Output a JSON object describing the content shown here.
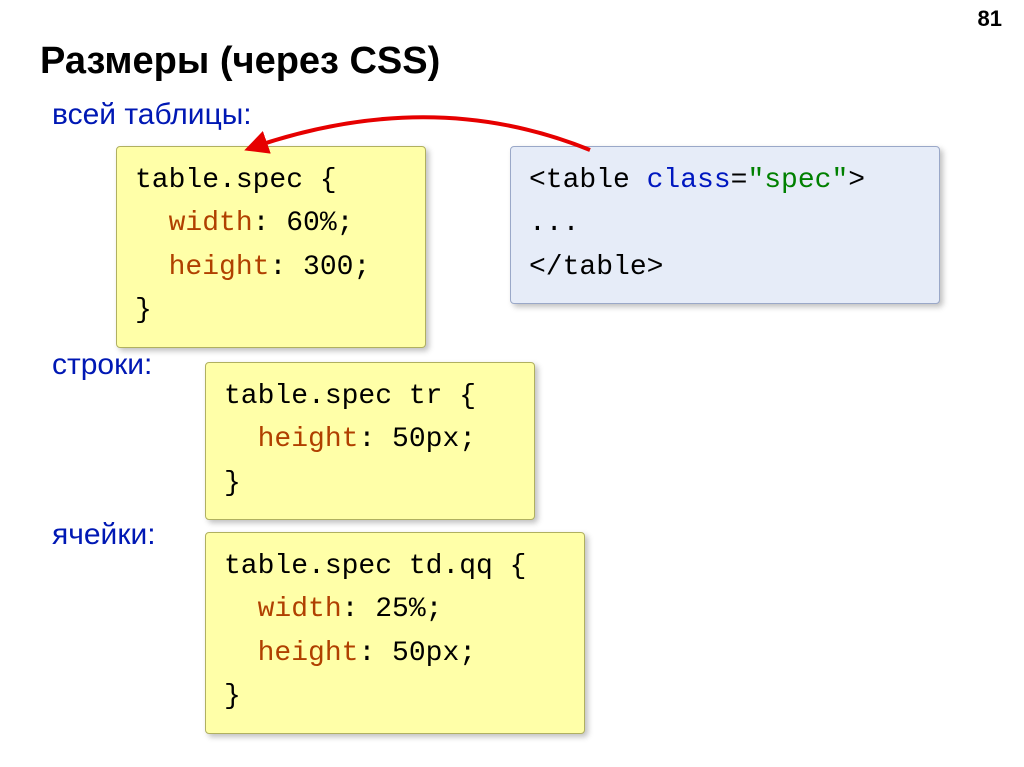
{
  "page_number": "81",
  "title": "Размеры (через CSS)",
  "labels": {
    "whole_table": "всей таблицы:",
    "rows": "строки:",
    "cells": "ячейки:"
  },
  "code": {
    "box1": {
      "l1_a": "table.spec {",
      "l2_a": "  ",
      "l2_b": "width",
      "l2_c": ": 60%;",
      "l3_a": "  ",
      "l3_b": "height",
      "l3_c": ": 300;",
      "l4_a": "}"
    },
    "box2": {
      "l1_a": "table.spec tr {",
      "l2_a": "  ",
      "l2_b": "height",
      "l2_c": ": 50px;",
      "l3_a": "}"
    },
    "box3": {
      "l1_a": "table.spec td.qq {",
      "l2_a": "  ",
      "l2_b": "width",
      "l2_c": ": 25%;",
      "l3_a": "  ",
      "l3_b": "height",
      "l3_c": ": 50px;",
      "l4_a": "}"
    },
    "html": {
      "l1_a": "<table ",
      "l1_b": "class",
      "l1_c": "=",
      "l1_d": "\"spec\"",
      "l1_e": ">",
      "l2_a": "...",
      "l3_a": "</table>"
    }
  }
}
